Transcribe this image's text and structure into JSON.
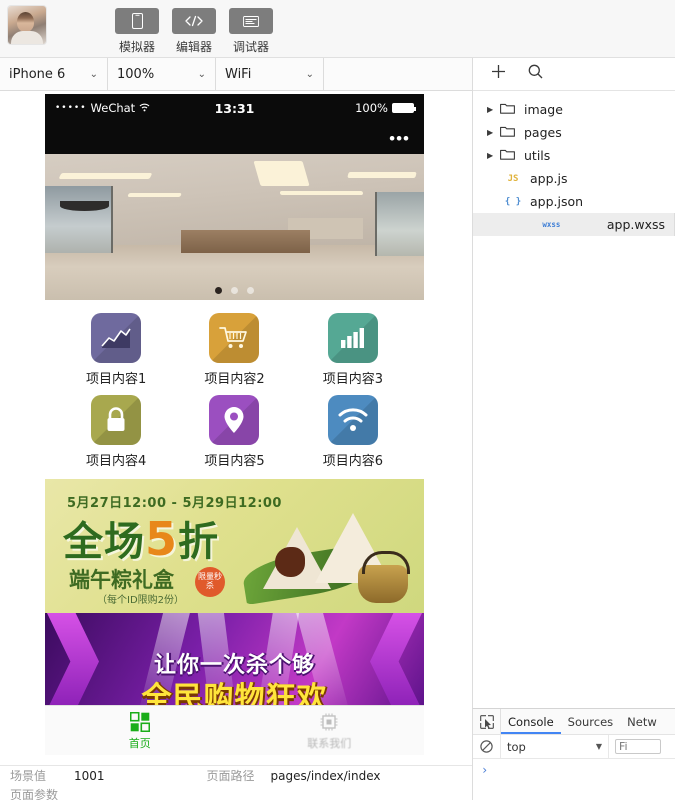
{
  "toolbar": {
    "avatar_alt": "user-avatar",
    "buttons": [
      {
        "label": "模拟器",
        "icon": "phone-icon"
      },
      {
        "label": "编辑器",
        "icon": "code-icon"
      },
      {
        "label": "调试器",
        "icon": "debug-icon"
      }
    ]
  },
  "selectbar": {
    "device": "iPhone 6",
    "zoom": "100%",
    "network": "WiFi",
    "caret": "⌄"
  },
  "simulator": {
    "statusbar": {
      "signal": "•••••",
      "carrier": "WeChat",
      "wifi_icon": "wifi-icon",
      "time": "13:31",
      "battery_percent": "100%"
    },
    "navbar": {
      "menu": "•••"
    },
    "carousel": {
      "dot_count": 3,
      "active_dot": 0,
      "image_alt": "office-lobby-photo"
    },
    "grid": [
      {
        "label": "项目内容1",
        "icon": "line-chart-icon",
        "color": "#6f6a9e"
      },
      {
        "label": "项目内容2",
        "icon": "shopping-cart-icon",
        "color": "#d8a13a"
      },
      {
        "label": "项目内容3",
        "icon": "bar-chart-icon",
        "color": "#55a894"
      },
      {
        "label": "项目内容4",
        "icon": "lock-icon",
        "color": "#a8a84e"
      },
      {
        "label": "项目内容5",
        "icon": "location-pin-icon",
        "color": "#9b4fc0"
      },
      {
        "label": "项目内容6",
        "icon": "wifi-signal-icon",
        "color": "#4d8bc0"
      }
    ],
    "banner_a": {
      "date_range": "5月27日12:00 - 5月29日12:00",
      "headline_prefix": "全场",
      "headline_number": "5",
      "headline_suffix": "折",
      "subtitle": "端午粽礼盒",
      "tag": "限量秒杀",
      "note": "（每个ID限购2份）"
    },
    "banner_b": {
      "line1": "让你一次杀个够",
      "line2": "全民购物狂欢"
    },
    "tabbar": [
      {
        "label": "首页",
        "icon": "grid-squares-icon",
        "active": true
      },
      {
        "label": "联系我们",
        "icon": "chip-icon",
        "active": false
      }
    ]
  },
  "infobar": {
    "scene_key": "场景值",
    "scene_value": "1001",
    "path_key": "页面路径",
    "path_value": "pages/index/index",
    "params_key": "页面参数"
  },
  "filepanel": {
    "add_icon": "plus-icon",
    "search_icon": "search-icon",
    "tree": [
      {
        "name": "image",
        "type": "folder",
        "expanded": false
      },
      {
        "name": "pages",
        "type": "folder",
        "expanded": false
      },
      {
        "name": "utils",
        "type": "folder",
        "expanded": false
      },
      {
        "name": "app.js",
        "type": "js",
        "badge": "JS",
        "selected": false
      },
      {
        "name": "app.json",
        "type": "json",
        "badge": "{ }",
        "selected": false
      },
      {
        "name": "app.wxss",
        "type": "wxss",
        "badge": "wxss",
        "selected": true
      }
    ]
  },
  "devtools": {
    "inspect_icon": "inspect-element-icon",
    "tabs": [
      {
        "label": "Console",
        "active": true
      },
      {
        "label": "Sources",
        "active": false
      },
      {
        "label": "Netw",
        "active": false
      }
    ],
    "clear_icon": "clear-console-icon",
    "context": "top",
    "context_caret": "▼",
    "filter_placeholder": "Fi",
    "prompt": "›"
  },
  "colors": {
    "accent_green": "#1aad19",
    "devtools_blue": "#4285f4",
    "toolbar_gray": "#7d7d7d"
  }
}
